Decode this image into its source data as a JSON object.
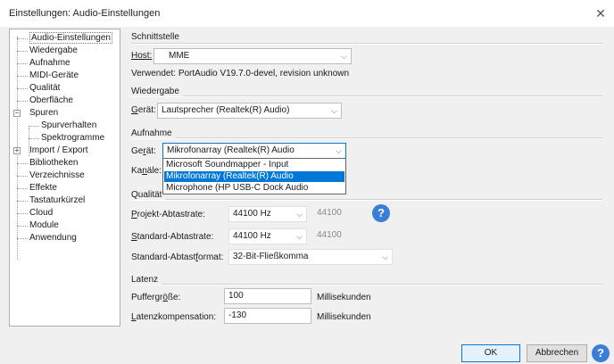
{
  "window": {
    "title": "Einstellungen: Audio-Einstellungen",
    "close_glyph": "✕"
  },
  "tree": {
    "items": [
      {
        "label": "Audio-Einstellungen",
        "selected": true
      },
      {
        "label": "Wiedergabe"
      },
      {
        "label": "Aufnahme"
      },
      {
        "label": "MIDI-Geräte"
      },
      {
        "label": "Qualität"
      },
      {
        "label": "Oberfläche"
      },
      {
        "label": "Spuren",
        "expander": "−"
      },
      {
        "label": "Spurverhalten"
      },
      {
        "label": "Spektrogramme"
      },
      {
        "label": "Import / Export",
        "expander": "+"
      },
      {
        "label": "Bibliotheken"
      },
      {
        "label": "Verzeichnisse"
      },
      {
        "label": "Effekte"
      },
      {
        "label": "Tastaturkürzel"
      },
      {
        "label": "Cloud"
      },
      {
        "label": "Module"
      },
      {
        "label": "Anwendung"
      }
    ]
  },
  "interface": {
    "group_label": "Schnittstelle",
    "host_label": "Host:",
    "host_value": "MME",
    "used_text": "Verwendet: PortAudio V19.7.0-devel, revision unknown"
  },
  "playback": {
    "group_label": "Wiedergabe",
    "device_label": "Gerät:",
    "device_value": "Lautsprecher (Realtek(R) Audio)"
  },
  "recording": {
    "group_label": "Aufnahme",
    "device_label": "Gerät:",
    "device_value": "Mikrofonarray (Realtek(R) Audio",
    "channels_label": "Kanäle:",
    "dropdown_options": [
      "Microsoft Soundmapper - Input",
      "Mikrofonarray (Realtek(R) Audio",
      "Microphone (HP USB-C Dock Audio"
    ],
    "highlighted_option": 1
  },
  "quality": {
    "group_label": "Qualität",
    "project_rate_label": "Projekt-Abtastrate:",
    "project_rate_value": "44100 Hz",
    "project_rate_text": "44100",
    "default_rate_label": "Standard-Abtastrate:",
    "default_rate_value": "44100 Hz",
    "default_rate_text": "44100",
    "default_format_label": "Standard-Abtastformat:",
    "default_format_value": "32-Bit-Fließkomma"
  },
  "latency": {
    "group_label": "Latenz",
    "buffer_label": "Puffergröße:",
    "buffer_value": "100",
    "buffer_unit": "Millisekunden",
    "compensation_label": "Latenzkompensation:",
    "compensation_value": "-130",
    "compensation_unit": "Millisekunden"
  },
  "buttons": {
    "ok": "OK",
    "cancel": "Abbrechen",
    "help": "?"
  },
  "icons": {
    "dropdown": "chevron-down-icon",
    "help": "help-icon",
    "close": "close-icon"
  },
  "colors": {
    "accent": "#0078d7",
    "help": "#3a7fd5",
    "panel": "#f0f0f0"
  }
}
